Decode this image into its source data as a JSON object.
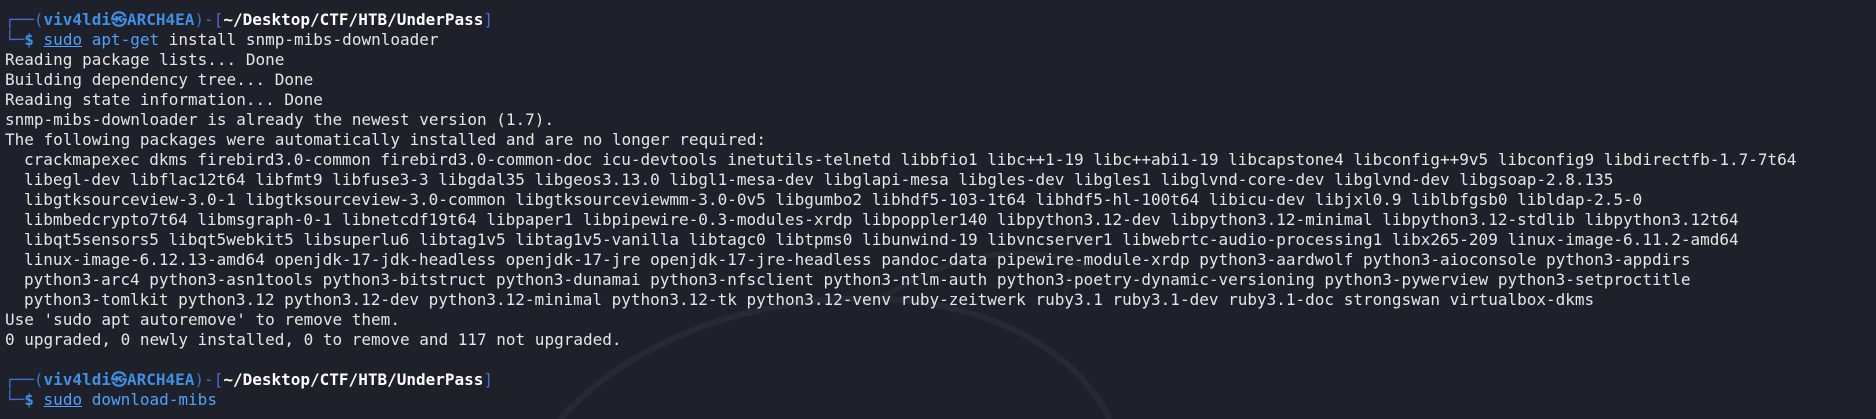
{
  "prompt": {
    "frame_top_left": "┌──(",
    "user": "viv4ldi",
    "at_symbol": "㉿",
    "host": "ARCH4EA",
    "frame_mid": ")-[",
    "path": "~/Desktop/CTF/HTB/UnderPass",
    "frame_end": "]",
    "frame_bottom": "└─",
    "sign": "$"
  },
  "command1": {
    "sudo": "sudo",
    "program": "apt-get",
    "args": " install snmp-mibs-downloader"
  },
  "output": [
    "Reading package lists... Done",
    "Building dependency tree... Done",
    "Reading state information... Done",
    "snmp-mibs-downloader is already the newest version (1.7).",
    "The following packages were automatically installed and are no longer required:"
  ],
  "packages": [
    "crackmapexec dkms firebird3.0-common firebird3.0-common-doc icu-devtools inetutils-telnetd libbfio1 libc++1-19 libc++abi1-19 libcapstone4 libconfig++9v5 libconfig9 libdirectfb-1.7-7t64",
    "libegl-dev libflac12t64 libfmt9 libfuse3-3 libgdal35 libgeos3.13.0 libgl1-mesa-dev libglapi-mesa libgles-dev libgles1 libglvnd-core-dev libglvnd-dev libgsoap-2.8.135",
    "libgtksourceview-3.0-1 libgtksourceview-3.0-common libgtksourceviewmm-3.0-0v5 libgumbo2 libhdf5-103-1t64 libhdf5-hl-100t64 libicu-dev libjxl0.9 liblbfgsb0 libldap-2.5-0",
    "libmbedcrypto7t64 libmsgraph-0-1 libnetcdf19t64 libpaper1 libpipewire-0.3-modules-xrdp libpoppler140 libpython3.12-dev libpython3.12-minimal libpython3.12-stdlib libpython3.12t64",
    "libqt5sensors5 libqt5webkit5 libsuperlu6 libtag1v5 libtag1v5-vanilla libtagc0 libtpms0 libunwind-19 libvncserver1 libwebrtc-audio-processing1 libx265-209 linux-image-6.11.2-amd64",
    "linux-image-6.12.13-amd64 openjdk-17-jdk-headless openjdk-17-jre openjdk-17-jre-headless pandoc-data pipewire-module-xrdp python3-aardwolf python3-aioconsole python3-appdirs",
    "python3-arc4 python3-asn1tools python3-bitstruct python3-dunamai python3-nfsclient python3-ntlm-auth python3-poetry-dynamic-versioning python3-pywerview python3-setproctitle",
    "python3-tomlkit python3.12 python3.12-dev python3.12-minimal python3.12-tk python3.12-venv ruby-zeitwerk ruby3.1 ruby3.1-dev ruby3.1-doc strongswan virtualbox-dkms"
  ],
  "output_tail": [
    "Use 'sudo apt autoremove' to remove them.",
    "0 upgraded, 0 newly installed, 0 to remove and 117 not upgraded."
  ],
  "command2": {
    "sudo": "sudo",
    "program": "download-mibs"
  },
  "colors": {
    "background": "#1e2129",
    "prompt_blue": "#3f8fe6",
    "command_blue": "#4ea1ff",
    "text": "#e6e6e6"
  }
}
